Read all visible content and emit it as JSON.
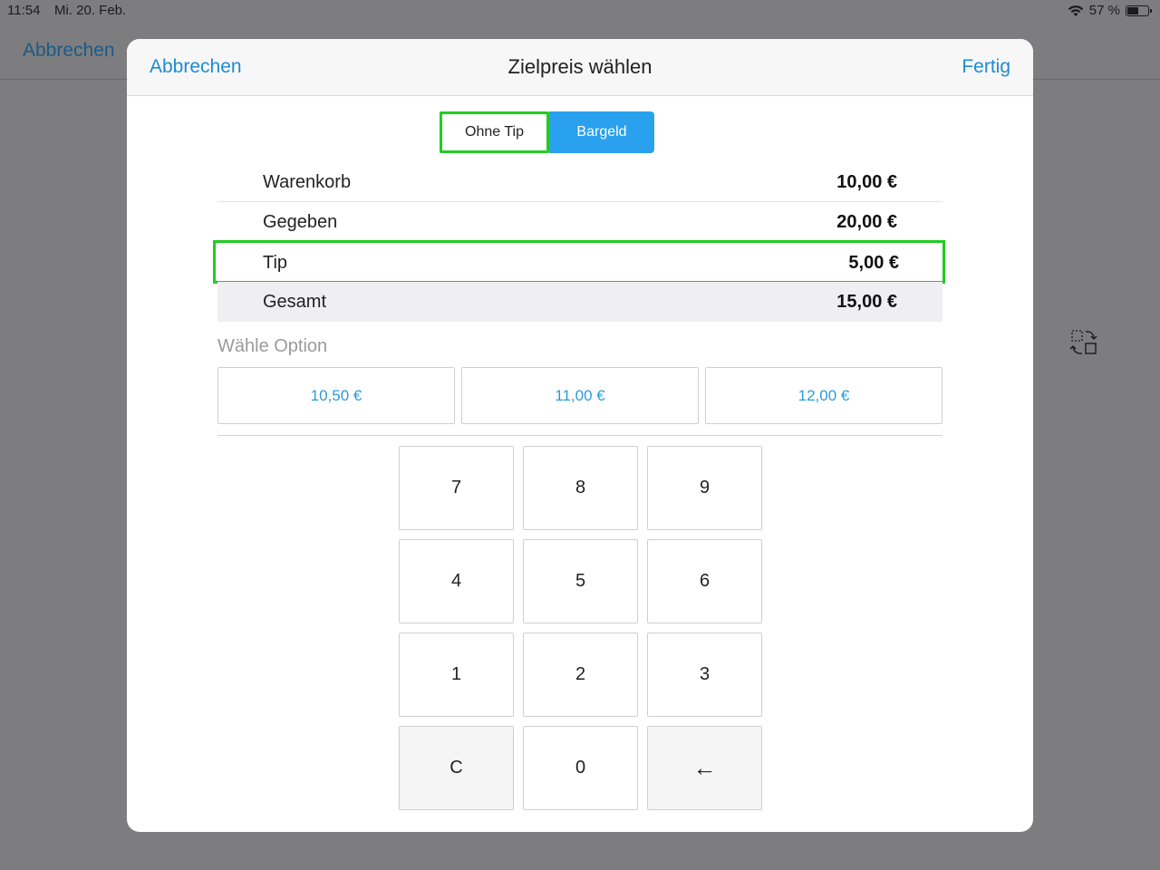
{
  "status_bar": {
    "time": "11:54",
    "date": "Mi. 20. Feb.",
    "battery": "57 %",
    "battery_level": 0.57
  },
  "background": {
    "cancel_label": "Abbrechen"
  },
  "modal": {
    "cancel_label": "Abbrechen",
    "title": "Zielpreis wählen",
    "done_label": "Fertig"
  },
  "segment": {
    "options": [
      "Ohne Tip",
      "Bargeld"
    ],
    "selected": "Bargeld"
  },
  "summary": [
    {
      "label": "Warenkorb",
      "value": "10,00 €"
    },
    {
      "label": "Gegeben",
      "value": "20,00 €"
    },
    {
      "label": "Tip",
      "value": "5,00 €"
    },
    {
      "label": "Gesamt",
      "value": "15,00 €"
    }
  ],
  "options_title": "Wähle Option",
  "options": [
    "10,50 €",
    "11,00 €",
    "12,00 €"
  ],
  "keypad": [
    "7",
    "8",
    "9",
    "4",
    "5",
    "6",
    "1",
    "2",
    "3",
    "C",
    "0",
    "←"
  ],
  "colors": {
    "accent": "#1e8bd0",
    "selected_segment": "#2aa1ee",
    "highlight_box": "#22cc22"
  }
}
